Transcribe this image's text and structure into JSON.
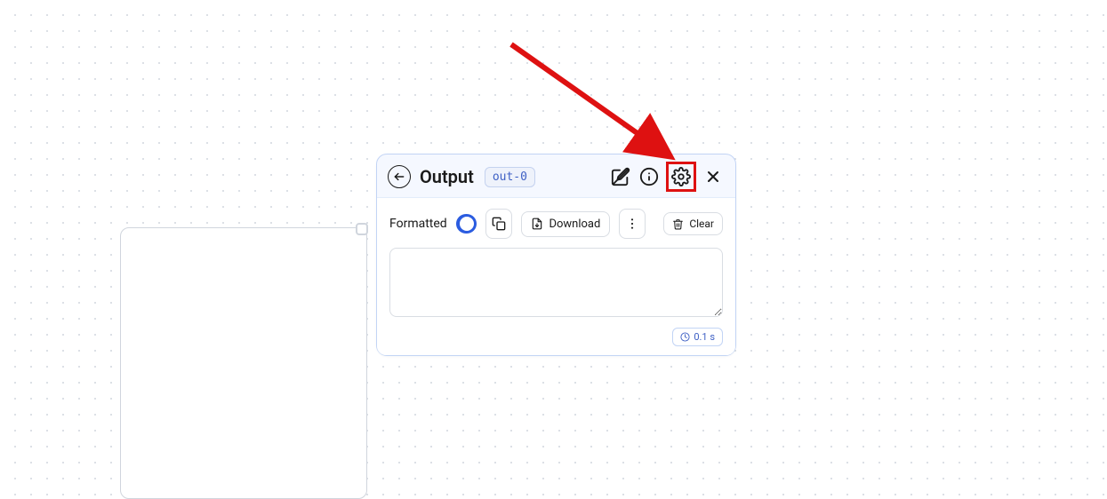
{
  "card": {
    "title": "Output",
    "tag": "out-0"
  },
  "toolbar": {
    "formatted_label": "Formatted",
    "download_label": "Download",
    "clear_label": "Clear"
  },
  "content": {
    "text": ""
  },
  "status": {
    "time": "0.1 s"
  }
}
